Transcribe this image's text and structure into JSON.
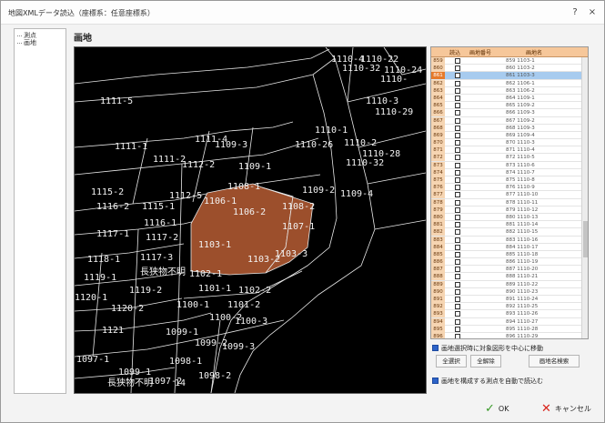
{
  "window": {
    "title": "地図XMLデータ読込（座標系：任意座標系）",
    "help_label": "?",
    "close_label": "×"
  },
  "tree": {
    "items": [
      "測点",
      "画地"
    ]
  },
  "panel": {
    "title": "画地"
  },
  "map": {
    "parcel_color": "#9c4f2c",
    "labels": [
      "1110-4",
      "1110-22",
      "1110-32",
      "1110-24",
      "1110-",
      "1111-5",
      "1110-3",
      "1110-29",
      "1110-1",
      "1111-1",
      "1111-4",
      "1109-3",
      "1110-26",
      "1110-2",
      "1110-28",
      "1110-32",
      "1111-2",
      "1112-2",
      "1109-1",
      "1108-1",
      "1109-2",
      "1109-4",
      "1115-2",
      "1112-5",
      "1106-1",
      "1106-2",
      "1108-2",
      "1116-2",
      "1115-1",
      "1116-1",
      "1107-1",
      "1117-1",
      "1117-2",
      "1103-1",
      "1103-2",
      "1103-3",
      "1118-1",
      "1117-3",
      "長狭物不明",
      "1102-1",
      "1119-1",
      "1119-2",
      "1101-1",
      "1102-2",
      "1120-1",
      "1120-2",
      "1100-1",
      "1101-2",
      "1100-2",
      "1100-3",
      "1121",
      "1099-1",
      "1099-2",
      "1099-3",
      "1097-1",
      "1098-1",
      "1099-1",
      "長狭物不明",
      "1098-2",
      "1097-2",
      "14"
    ]
  },
  "grid": {
    "headers": [
      "読込",
      "画地番号",
      "画地名"
    ],
    "rows": [
      {
        "num": "859",
        "code": "859 1103-1"
      },
      {
        "num": "860",
        "code": "860 1103-2"
      },
      {
        "num": "861",
        "code": "861 1103-3"
      },
      {
        "num": "862",
        "code": "862 1106-1"
      },
      {
        "num": "863",
        "code": "863 1106-2"
      },
      {
        "num": "864",
        "code": "864 1109-1"
      },
      {
        "num": "865",
        "code": "865 1109-2"
      },
      {
        "num": "866",
        "code": "866 1109-3"
      },
      {
        "num": "867",
        "code": "867 1109-2"
      },
      {
        "num": "868",
        "code": "868 1109-3"
      },
      {
        "num": "869",
        "code": "869 1109-4"
      },
      {
        "num": "870",
        "code": "870 1110-3"
      },
      {
        "num": "871",
        "code": "871 1110-4"
      },
      {
        "num": "872",
        "code": "872 1110-5"
      },
      {
        "num": "873",
        "code": "873 1110-6"
      },
      {
        "num": "874",
        "code": "874 1110-7"
      },
      {
        "num": "875",
        "code": "875 1110-8"
      },
      {
        "num": "876",
        "code": "876 1110-9"
      },
      {
        "num": "877",
        "code": "877 1110-10"
      },
      {
        "num": "878",
        "code": "878 1110-11"
      },
      {
        "num": "879",
        "code": "879 1110-12"
      },
      {
        "num": "880",
        "code": "880 1110-13"
      },
      {
        "num": "881",
        "code": "881 1110-14"
      },
      {
        "num": "882",
        "code": "882 1110-15"
      },
      {
        "num": "883",
        "code": "883 1110-16"
      },
      {
        "num": "884",
        "code": "884 1110-17"
      },
      {
        "num": "885",
        "code": "885 1110-18"
      },
      {
        "num": "886",
        "code": "886 1110-19"
      },
      {
        "num": "887",
        "code": "887 1110-20"
      },
      {
        "num": "888",
        "code": "888 1110-21"
      },
      {
        "num": "889",
        "code": "889 1110-22"
      },
      {
        "num": "890",
        "code": "890 1110-23"
      },
      {
        "num": "891",
        "code": "891 1110-24"
      },
      {
        "num": "892",
        "code": "892 1110-25"
      },
      {
        "num": "893",
        "code": "893 1110-26"
      },
      {
        "num": "894",
        "code": "894 1110-27"
      },
      {
        "num": "895",
        "code": "895 1110-28"
      },
      {
        "num": "896",
        "code": "896 1110-29"
      }
    ],
    "selected_index": 2
  },
  "options": {
    "center_on_select": "画地選択時に対象図形を中心に移動",
    "auto_load_points": "画地を構成する測点を自動で読込む"
  },
  "buttons": {
    "select_all": "全選択",
    "clear_all": "全解除",
    "search_name": "画地名検索",
    "ok": "OK",
    "cancel": "キャンセル"
  }
}
